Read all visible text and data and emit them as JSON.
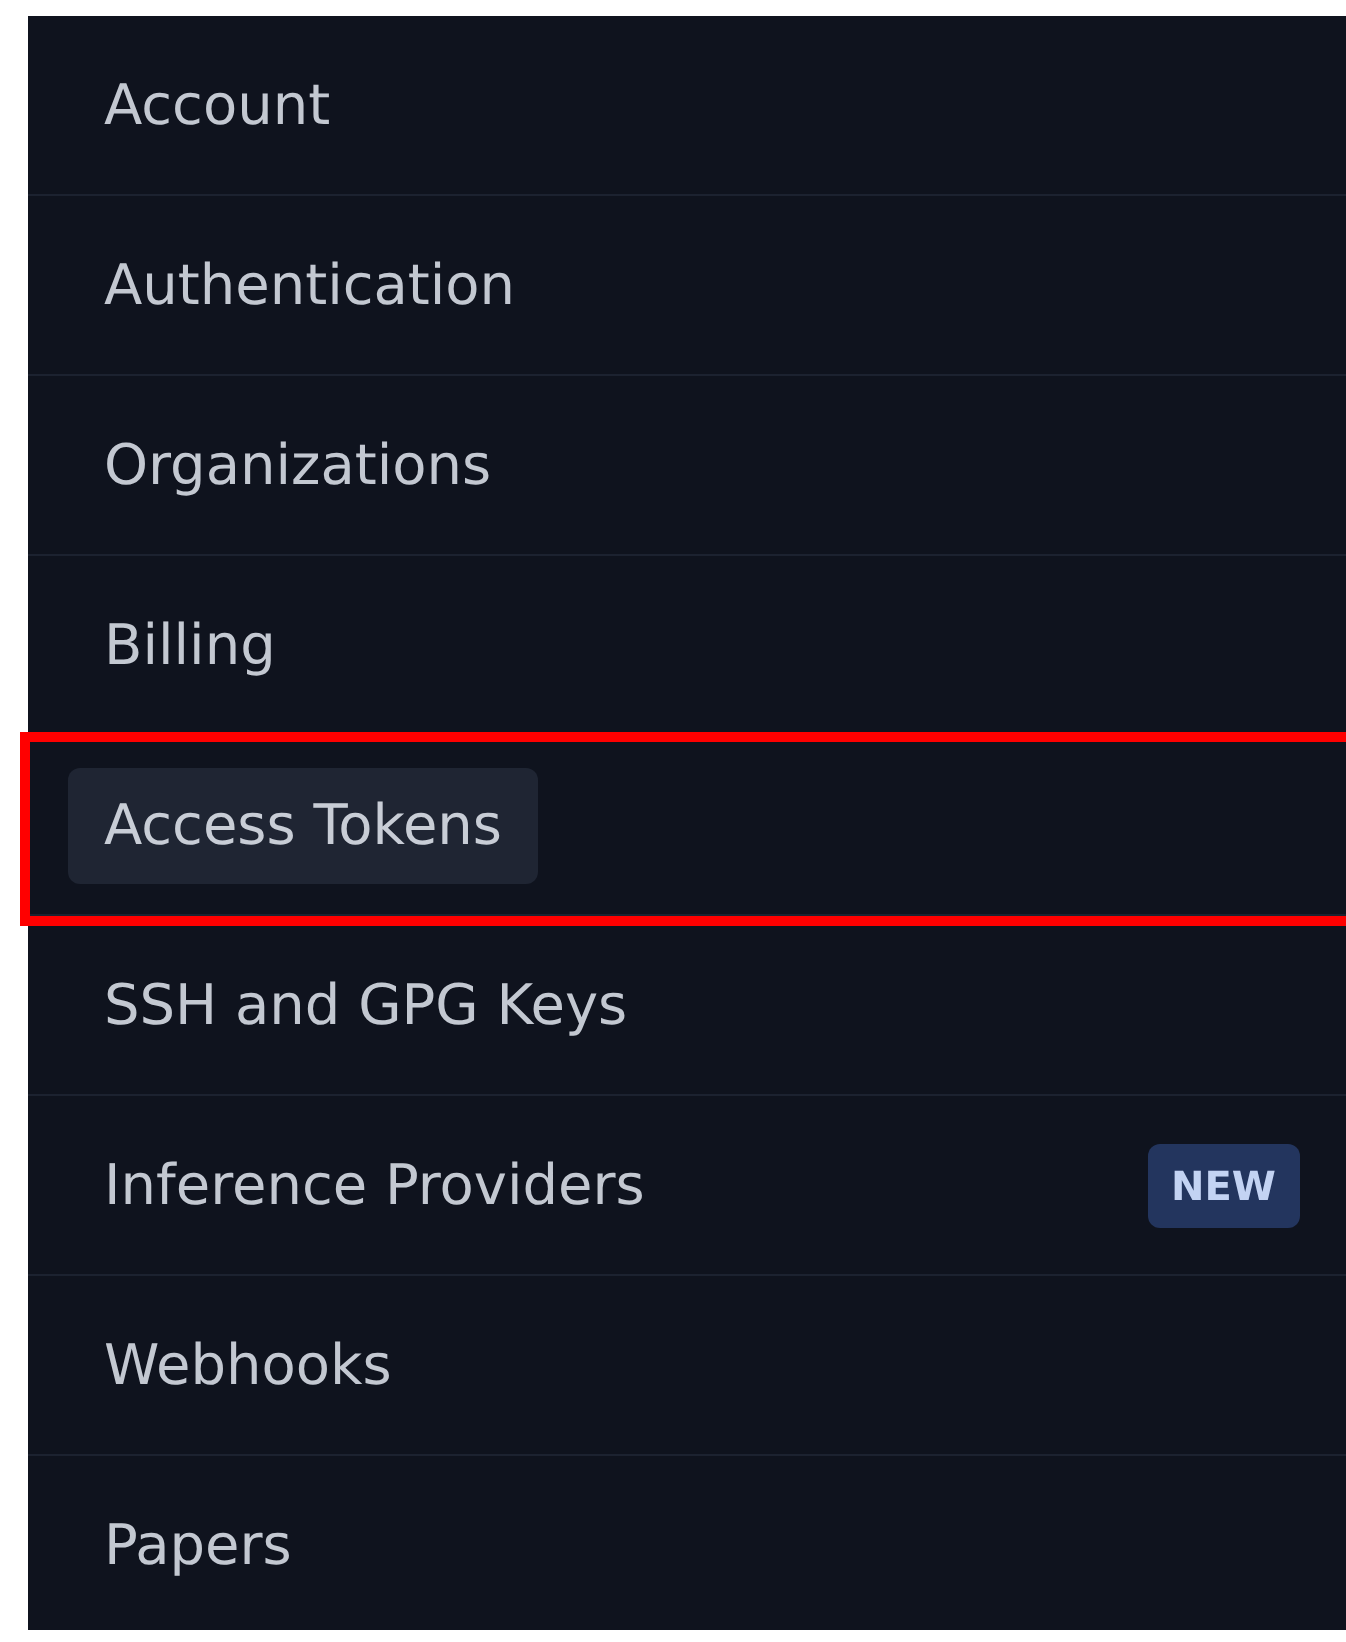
{
  "menu": {
    "items": [
      {
        "label": "Account",
        "selected": false,
        "highlighted": false
      },
      {
        "label": "Authentication",
        "selected": false,
        "highlighted": false
      },
      {
        "label": "Organizations",
        "selected": false,
        "highlighted": false
      },
      {
        "label": "Billing",
        "selected": false,
        "highlighted": false
      },
      {
        "label": "Access Tokens",
        "selected": true,
        "highlighted": true
      },
      {
        "label": "SSH and GPG Keys",
        "selected": false,
        "highlighted": false
      },
      {
        "label": "Inference Providers",
        "selected": false,
        "highlighted": false,
        "badge": "NEW"
      },
      {
        "label": "Webhooks",
        "selected": false,
        "highlighted": false
      },
      {
        "label": "Papers",
        "selected": false,
        "highlighted": false
      }
    ]
  }
}
